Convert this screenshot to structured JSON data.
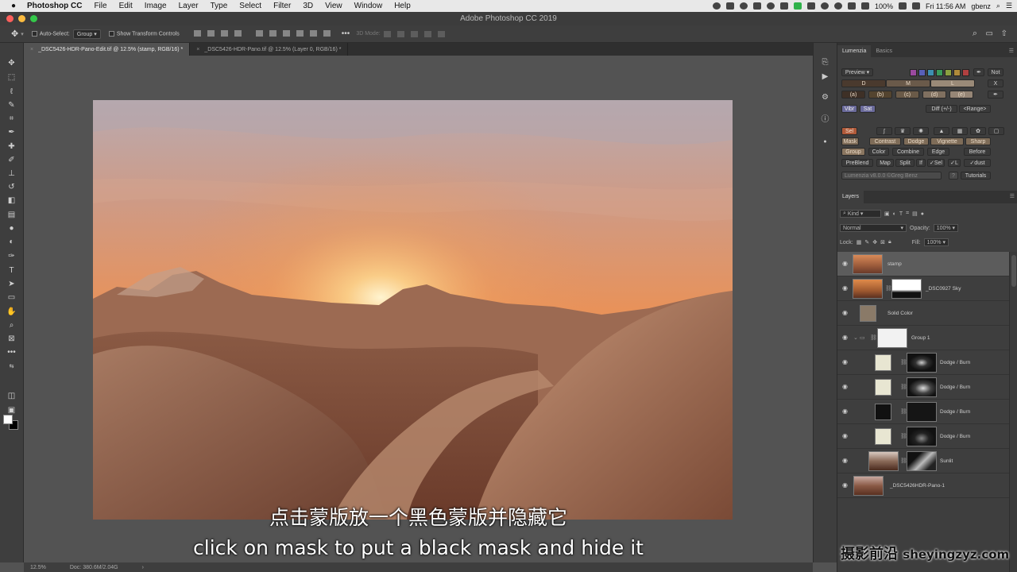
{
  "menubar": {
    "app": "Photoshop CC",
    "items": [
      "File",
      "Edit",
      "Image",
      "Layer",
      "Type",
      "Select",
      "Filter",
      "3D",
      "View",
      "Window",
      "Help"
    ],
    "battery": "100%",
    "clock": "Fri 11:56 AM",
    "user": "gbenz"
  },
  "window": {
    "title": "Adobe Photoshop CC 2019"
  },
  "options": {
    "auto_select_label": "Auto-Select:",
    "auto_select_value": "Group",
    "transform_label": "Show Transform Controls",
    "mode3d": "3D Mode:"
  },
  "tabs": [
    {
      "label": "_DSC5426-HDR-Pano-Edit.tif @ 12.5% (stamp, RGB/16) *"
    },
    {
      "label": "_DSC5426-HDR-Pano.tif @ 12.5% (Layer 0, RGB/16) *"
    }
  ],
  "status": {
    "zoom": "12.5%",
    "doc": "Doc: 380.6M/2.04G"
  },
  "subtitles": {
    "zh": "点击蒙版放一个黑色蒙版并隐藏它",
    "en": "click on mask to put a black mask and hide it"
  },
  "panels": {
    "top_tabs": [
      "Lumenzia",
      "Basics"
    ],
    "lumenzia": {
      "preview": "Preview",
      "not": "Not",
      "d": "D",
      "m": "M",
      "l": "L",
      "x": "X",
      "a": "(a)",
      "b": "(b)",
      "c": "(c)",
      "dd": "(d)",
      "e": "(e)",
      "vibr": "Vibr",
      "sat": "Sat",
      "diff": "Diff (+/-)",
      "range": "<Range>",
      "sel": "Sel",
      "mask": "Mask",
      "contrast": "Contrast",
      "dodge": "Dodge",
      "vignette": "Vignette",
      "sharp": "Sharp",
      "group": "Group",
      "color": "Color",
      "combine": "Combine",
      "edge": "Edge",
      "before": "Before",
      "preblend": "PreBlend",
      "map": "Map",
      "split": "Split",
      "if": "If",
      "vsel": "✓Sel",
      "vl": "✓L",
      "vdust": "✓dust",
      "version": "Lumenzia v8.0.0 ©Greg Benz",
      "help": "?",
      "tutorials": "Tutorials"
    },
    "layers_tab": "Layers",
    "kind": "Kind",
    "blend": "Normal",
    "opacity_label": "Opacity:",
    "opacity": "100%",
    "lock_label": "Lock:",
    "fill_label": "Fill:",
    "fill": "100%",
    "layers": [
      {
        "name": "stamp"
      },
      {
        "name": "_DSC0927 Sky"
      },
      {
        "name": "Solid Color"
      },
      {
        "name": "Group 1"
      },
      {
        "name": "Dodge / Burn"
      },
      {
        "name": "Dodge / Burn"
      },
      {
        "name": "Dodge / Burn"
      },
      {
        "name": "Dodge / Burn"
      },
      {
        "name": "Sunlit"
      },
      {
        "name": "_DSC5426HDR-Pano-1"
      }
    ]
  },
  "watermark": {
    "text": "摄影前沿",
    "url": "sheyingzyz.com"
  },
  "colors": {
    "accent_orange": "#e68a4a",
    "panel": "#3e3e3e",
    "canvas": "#535353"
  }
}
